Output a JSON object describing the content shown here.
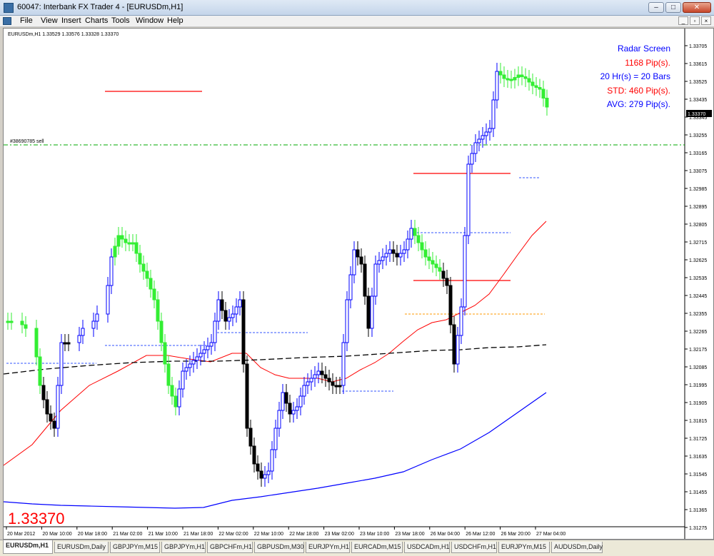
{
  "window": {
    "title": "60047: Interbank FX Trader 4 - [EURUSDm,H1]"
  },
  "window_buttons": {
    "minimize": "‒",
    "maximize": "□",
    "close": "✕"
  },
  "mdi_buttons": {
    "minimize": "_",
    "restore": "▫",
    "close": "×"
  },
  "menu": [
    "File",
    "View",
    "Insert",
    "Charts",
    "Tools",
    "Window",
    "Help"
  ],
  "chart": {
    "header": "EURUSDm,H1  1.33529 1.33576 1.33328 1.33370",
    "order_label": "#38690785 sell",
    "big_price": "1.33370",
    "current_price_tag": "1.33370",
    "price_levels": [
      "1.33705",
      "1.33615",
      "1.33525",
      "1.33435",
      "1.33345",
      "1.33255",
      "1.33165",
      "1.33075",
      "1.32985",
      "1.32895",
      "1.32805",
      "1.32715",
      "1.32625",
      "1.32535",
      "1.32445",
      "1.32355",
      "1.32265",
      "1.32175",
      "1.32085",
      "1.31995",
      "1.31905",
      "1.31815",
      "1.31725",
      "1.31635",
      "1.31545",
      "1.31455",
      "1.31365",
      "1.31275"
    ],
    "time_labels": [
      "20 Mar 2012",
      "20 Mar 10:00",
      "20 Mar 18:00",
      "21 Mar 02:00",
      "21 Mar 10:00",
      "21 Mar 18:00",
      "22 Mar 02:00",
      "22 Mar 10:00",
      "22 Mar 18:00",
      "23 Mar 02:00",
      "23 Mar 10:00",
      "23 Mar 18:00",
      "26 Mar 04:00",
      "26 Mar 12:00",
      "26 Mar 20:00",
      "27 Mar 04:00"
    ],
    "radar": {
      "title": "Radar Screen",
      "line1": "1168 Pip(s).",
      "line2": "20 Hr(s) = 20 Bars",
      "line3": "STD: 460 Pip(s).",
      "line4": "AVG: 279 Pip(s)."
    },
    "colors": {
      "bull": "#0000ff",
      "bear": "#000000",
      "highlight": "#33ee33",
      "ma_fast": "#ff0000",
      "ma_slow": "#0000ff",
      "ma_long": "#000000",
      "order_line": "#00aa00"
    }
  },
  "tabs": [
    "EURUSDm,H1",
    "EURUSDm,Daily",
    "GBPJPYm,M15",
    "GBPJPYm,H1",
    "GBPCHFm,H1",
    "GBPUSDm,M30",
    "EURJPYm,H1",
    "EURCADm,M15",
    "USDCADm,H1",
    "USDCHFm,H1",
    "EURJPYm,M15",
    "AUDUSDm,Daily"
  ]
}
